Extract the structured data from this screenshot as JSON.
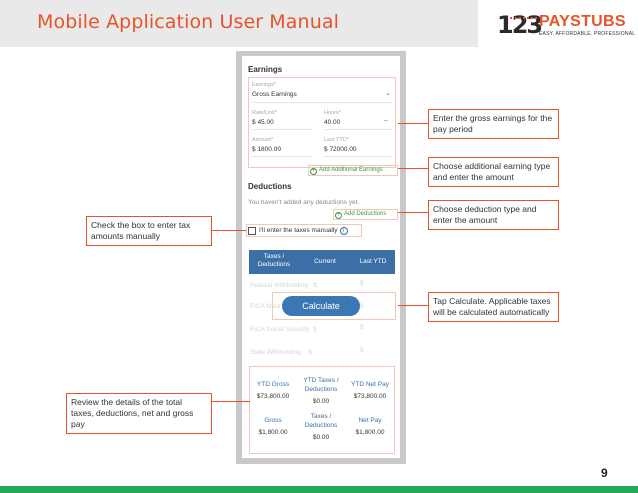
{
  "header": {
    "title": "Mobile Application User Manual",
    "logo": {
      "numbers": "123",
      "brand": "PAYSTUBS",
      "tagline": "EASY. AFFORDABLE. PROFESSIONAL"
    }
  },
  "app": {
    "earnings_title": "Earnings",
    "earnings_field": {
      "label": "Earnings*",
      "value": "Gross Earnings"
    },
    "rate": {
      "label": "Rate/Unit*",
      "currency": "$",
      "value": "45.00"
    },
    "hours": {
      "label": "Hours*",
      "value": "40.00"
    },
    "amount": {
      "label": "Amount*",
      "currency": "$",
      "value": "1800.00"
    },
    "last_ytd": {
      "label": "Last YTD*",
      "currency": "$",
      "value": "72000.00"
    },
    "add_earnings": "Add Additional Earnings",
    "deductions_title": "Deductions",
    "deductions_empty": "You haven't added any deductions yet.",
    "add_deductions": "Add Deductions",
    "manual_taxes_label": "I'll enter the taxes manually",
    "table_headers": [
      "Taxes / Deductions",
      "Current",
      "Last YTD"
    ],
    "ghost_rows": [
      {
        "label": "Federal Withholding",
        "current": "$",
        "ytd": "$"
      },
      {
        "label": "FICA Medi",
        "current": "$",
        "ytd": "$"
      },
      {
        "label": "FICA Social Security",
        "current": "$",
        "ytd": "$"
      },
      {
        "label": "State Withholding",
        "current": "$",
        "ytd": "$"
      }
    ],
    "calculate_label": "Calculate",
    "summary": {
      "ytd_gross_label": "YTD Gross",
      "ytd_gross_value": "$73,800.00",
      "ytd_taxes_label": "YTD Taxes / Deductions",
      "ytd_taxes_value": "$0.00",
      "ytd_net_label": "YTD Net Pay",
      "ytd_net_value": "$73,800.00",
      "gross_label": "Gross",
      "gross_value": "$1,800.00",
      "taxes_label": "Taxes / Deductions",
      "taxes_value": "$0.00",
      "net_label": "Net Pay",
      "net_value": "$1,800.00"
    }
  },
  "callouts": {
    "gross_earnings": "Enter the gross earnings for the pay period",
    "additional_earning": "Choose additional earning type and enter the amount",
    "deduction_type": "Choose deduction type and enter the amount",
    "tax_checkbox": "Check the box to enter tax amounts manually",
    "calculate": "Tap Calculate. Applicable taxes will be calculated automatically",
    "review": "Review the details of the total taxes, deductions, net and gross pay"
  },
  "page_number": "9",
  "colors": {
    "accent": "#e8542a",
    "table_header": "#3b6fa6",
    "footer": "#24a85a",
    "link_green": "#3e9a45"
  }
}
